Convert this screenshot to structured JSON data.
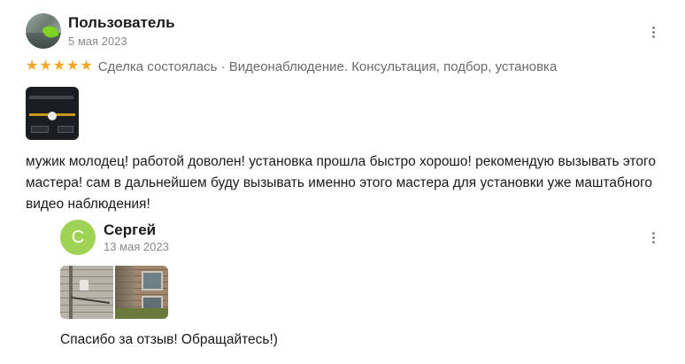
{
  "review": {
    "author": {
      "name": "Пользователь",
      "date": "5 мая 2023"
    },
    "rating": {
      "stars": 5,
      "max": 5,
      "star_color": "#f5a623"
    },
    "deal_text": "Сделка состоялась · Видеонаблюдение. Консультация, подбор, установка",
    "photos": [
      {
        "alt": "app-screenshot-photo"
      }
    ],
    "text": "мужик молодец! работой доволен! установка прошла быстро хорошо! рекомендую вызывать этого мастера! сам в дальнейшем буду вызывать именно этого мастера для установки уже маштабного видео наблюдения!",
    "menu_icon": "more-vertical-icon"
  },
  "reply": {
    "author": {
      "name": "Сергей",
      "initial": "С",
      "date": "13 мая 2023",
      "avatar_color": "#9fd356"
    },
    "photos": [
      {
        "alt": "wall-camera-photo"
      },
      {
        "alt": "building-facade-photo"
      }
    ],
    "text": "Спасибо за отзыв! Обращайтесь!)",
    "menu_icon": "more-vertical-icon"
  }
}
